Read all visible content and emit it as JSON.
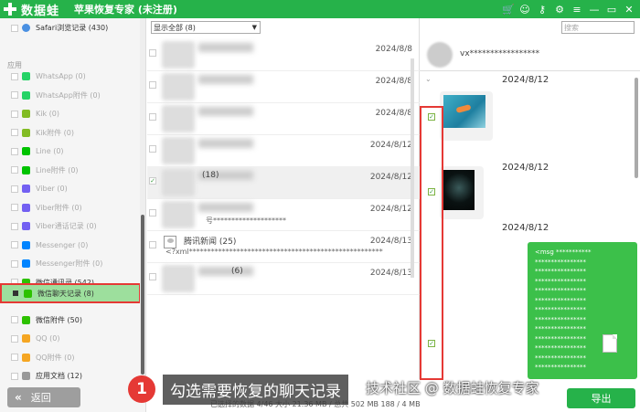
{
  "titlebar": {
    "logo_text": "数据蛙",
    "app_title": "苹果恢复专家 (未注册)",
    "colors": {
      "brand": "#26b24a"
    },
    "icons": [
      "cart-icon",
      "user-icon",
      "key-icon",
      "settings-icon",
      "menu-icon",
      "minimize-icon",
      "restore-icon",
      "close-icon"
    ]
  },
  "sidebar": {
    "top_item": "Safari浏览记录 (430)",
    "section_label": "应用",
    "items": [
      {
        "label": "WhatsApp (0)",
        "icon": "whatsapp-icon",
        "color": "#25d366"
      },
      {
        "label": "WhatsApp附件 (0)",
        "icon": "whatsapp-attachment-icon",
        "color": "#25d366"
      },
      {
        "label": "Kik (0)",
        "icon": "kik-icon",
        "color": "#82bc23"
      },
      {
        "label": "Kik附件 (0)",
        "icon": "kik-attachment-icon",
        "color": "#82bc23"
      },
      {
        "label": "Line (0)",
        "icon": "line-icon",
        "color": "#00c300"
      },
      {
        "label": "Line附件 (0)",
        "icon": "line-attachment-icon",
        "color": "#00c300"
      },
      {
        "label": "Viber (0)",
        "icon": "viber-icon",
        "color": "#7360f2"
      },
      {
        "label": "Viber附件 (0)",
        "icon": "viber-attachment-icon",
        "color": "#7360f2"
      },
      {
        "label": "Viber通话记录 (0)",
        "icon": "viber-call-icon",
        "color": "#7360f2"
      },
      {
        "label": "Messenger (0)",
        "icon": "messenger-icon",
        "color": "#0084ff"
      },
      {
        "label": "Messenger附件 (0)",
        "icon": "messenger-attachment-icon",
        "color": "#0084ff"
      },
      {
        "label": "微信通讯录 (542)",
        "icon": "wechat-contacts-icon",
        "color": "#2dc100"
      },
      {
        "label": "微信聊天记录 (8)",
        "icon": "wechat-chat-icon",
        "color": "#2dc100"
      },
      {
        "label": "微信附件 (50)",
        "icon": "wechat-attachment-icon",
        "color": "#2dc100"
      },
      {
        "label": "QQ (0)",
        "icon": "qq-icon",
        "color": "#f5a623"
      },
      {
        "label": "QQ附件 (0)",
        "icon": "qq-attachment-icon",
        "color": "#f5a623"
      },
      {
        "label": "应用文档 (12)",
        "icon": "app-docs-icon",
        "color": "#999999"
      }
    ],
    "back_label": "返回"
  },
  "middle": {
    "filter_value": "显示全部 (8)",
    "rows": [
      {
        "date": "2024/8/8",
        "name": "",
        "preview": ""
      },
      {
        "date": "2024/8/8",
        "name": "",
        "preview": ""
      },
      {
        "date": "2024/8/8",
        "name": "",
        "preview": ""
      },
      {
        "date": "2024/8/12",
        "name": "",
        "preview": ""
      },
      {
        "date": "2024/8/12",
        "name": "(18)",
        "preview": ""
      },
      {
        "date": "2024/8/12",
        "name": "",
        "preview": "号********************"
      },
      {
        "date": "2024/8/13",
        "name": "腾讯新闻 (25)",
        "preview": "<?xml*****************************************************"
      },
      {
        "date": "2024/8/13",
        "name": "(6)",
        "preview": ""
      }
    ]
  },
  "chat": {
    "search_placeholder": "搜索",
    "contact_name": "vx*****************",
    "dates": [
      "2024/8/12",
      "2024/8/12",
      "2024/8/12"
    ],
    "message_lines": [
      "<msg ***********",
      "****************",
      "****************",
      "****************",
      "****************",
      "****************",
      "****************",
      "****************",
      "****************",
      "****************",
      "****************",
      "****************",
      "****************"
    ],
    "export_label": "导出"
  },
  "status": {
    "text": "已选择的数据 4/46  大小 21.36 MB / 总共 502 MB  188 / 4 MB"
  },
  "caption": {
    "step_number": "1",
    "text": "勾选需要恢复的聊天记录",
    "watermark": "技术社区 @ 数据蛙恢复专家"
  }
}
